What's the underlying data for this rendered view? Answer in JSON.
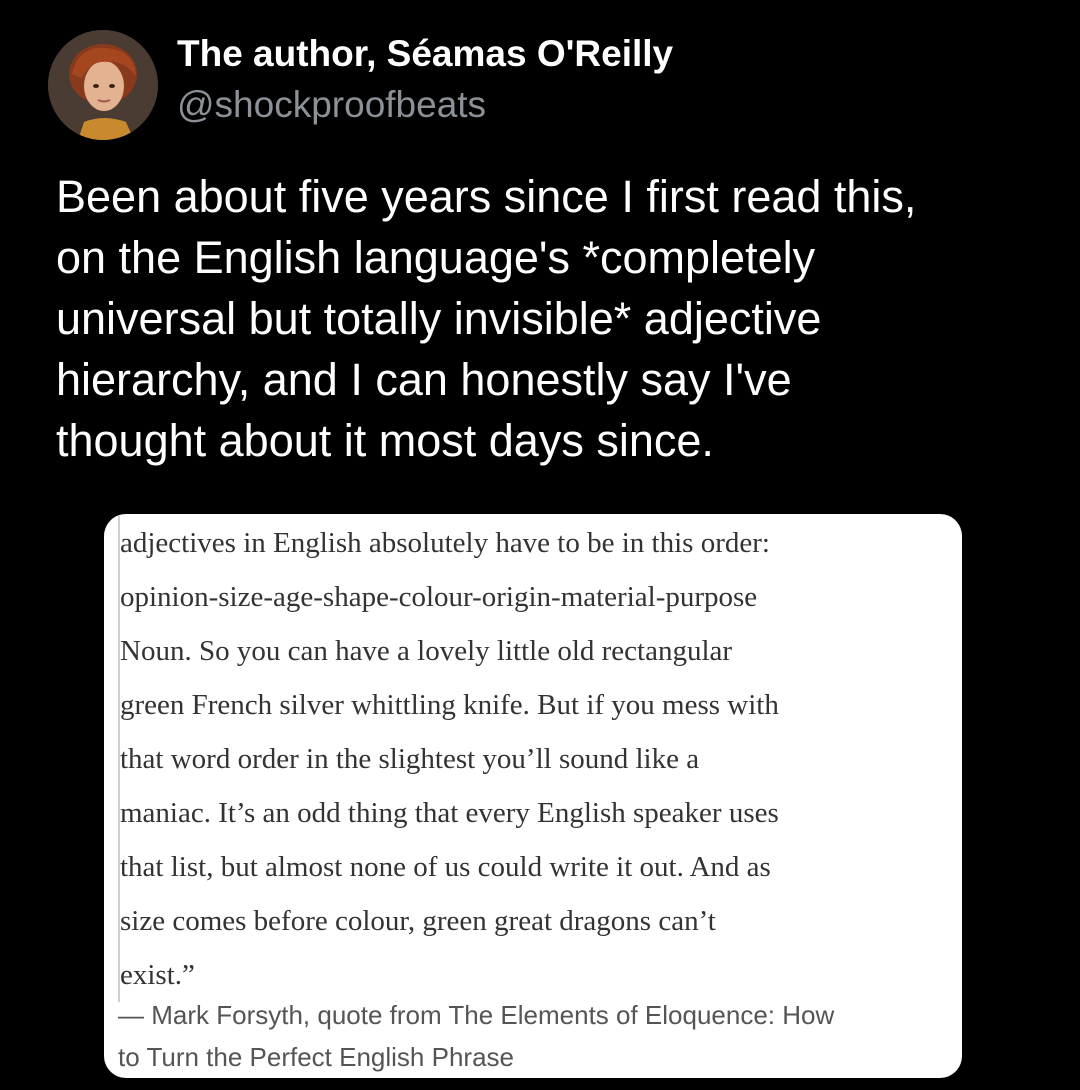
{
  "tweet": {
    "author": {
      "display_name": "The author, Séamas O'Reilly",
      "handle": "@shockproofbeats",
      "avatar_icon": "avatar-illustration"
    },
    "text_lines": [
      "Been about five years since I first read this,",
      "on the English language's *completely",
      "universal but totally invisible* adjective",
      "hierarchy, and I can honestly say I've",
      "thought about it most days since."
    ]
  },
  "quote": {
    "lines": [
      "adjectives in English absolutely have to be in this order:",
      "opinion-size-age-shape-colour-origin-material-purpose",
      "Noun. So you can have a lovely little old rectangular",
      "green French silver whittling knife. But if you mess with",
      "that word order in the slightest you’ll sound like a",
      "maniac. It’s an odd thing that every English speaker uses",
      "that list, but almost none of us could write it out. And as",
      "size comes before colour, green great dragons can’t",
      "exist.”"
    ],
    "attribution_lines": [
      "— Mark Forsyth, quote from The Elements of Eloquence: How",
      "to Turn the Perfect English Phrase"
    ]
  },
  "colors": {
    "background": "#000000",
    "handle": "#8b9197",
    "card": "#ffffff",
    "quote_text": "#333333"
  }
}
